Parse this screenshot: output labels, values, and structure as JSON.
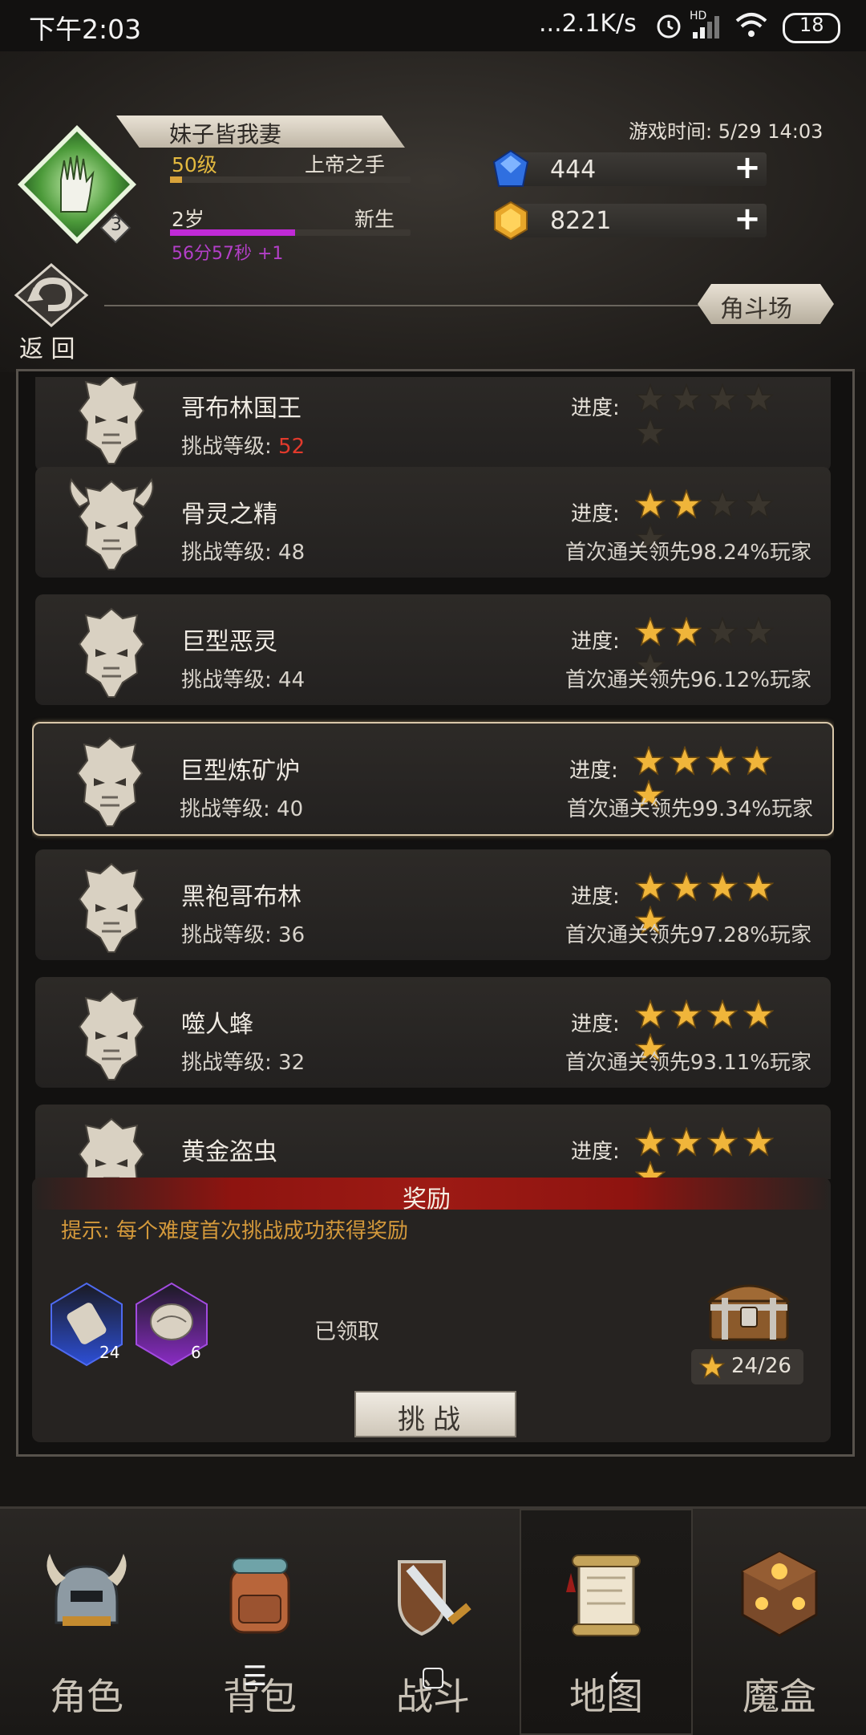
{
  "status_bar": {
    "time": "下午2:03",
    "network": "...2.1K/s",
    "network_type": "HD",
    "battery": "18"
  },
  "player": {
    "name": "妹子皆我妻",
    "level": "50级",
    "title": "上帝之手",
    "age": "2岁",
    "age_stage": "新生",
    "timer": "56分57秒 +1",
    "rank_badge": "3",
    "level_progress": 0.05,
    "age_progress": 0.52
  },
  "game_time": "游戏时间: 5/29 14:03",
  "currency": {
    "gems": "444",
    "gold": "8221"
  },
  "nav_header": {
    "back_label": "返 回",
    "arena_label": "角斗场"
  },
  "list": {
    "progress_label": "进度:",
    "level_label": "挑战等级:",
    "rows": [
      {
        "name": "哥布林国王",
        "level": "52",
        "stars": 0,
        "first_clear": ""
      },
      {
        "name": "骨灵之精",
        "level": "48",
        "stars": 2,
        "first_clear": "首次通关领先98.24%玩家"
      },
      {
        "name": "巨型恶灵",
        "level": "44",
        "stars": 2,
        "first_clear": "首次通关领先96.12%玩家"
      },
      {
        "name": "巨型炼矿炉",
        "level": "40",
        "stars": 5,
        "first_clear": "首次通关领先99.34%玩家",
        "selected": true
      },
      {
        "name": "黑袍哥布林",
        "level": "36",
        "stars": 5,
        "first_clear": "首次通关领先97.28%玩家"
      },
      {
        "name": "噬人蜂",
        "level": "32",
        "stars": 5,
        "first_clear": "首次通关领先93.11%玩家"
      },
      {
        "name": "黄金盗虫",
        "level": "",
        "stars": 5,
        "first_clear": ""
      }
    ]
  },
  "reward": {
    "title": "奖励",
    "hint": "提示: 每个难度首次挑战成功获得奖励",
    "items": [
      {
        "icon": "scroll-icon",
        "count": "24",
        "color": "#2d4fd6"
      },
      {
        "icon": "shell-icon",
        "count": "6",
        "color": "#8a2cc4"
      }
    ],
    "claimed_label": "已领取",
    "star_count": "24/26",
    "challenge_label": "挑战"
  },
  "bottom_nav": [
    {
      "label": "角色",
      "icon": "helmet-icon"
    },
    {
      "label": "背包",
      "icon": "backpack-icon"
    },
    {
      "label": "战斗",
      "icon": "sword-shield-icon"
    },
    {
      "label": "地图",
      "icon": "map-scroll-icon",
      "active": true
    },
    {
      "label": "魔盒",
      "icon": "magic-box-icon"
    }
  ],
  "colors": {
    "accent_red": "#9d1a14",
    "star_gold": "#f0b53a",
    "level_red": "#e23a2c",
    "hint_orange": "#d4993b",
    "age_purple": "#c02ad6"
  }
}
